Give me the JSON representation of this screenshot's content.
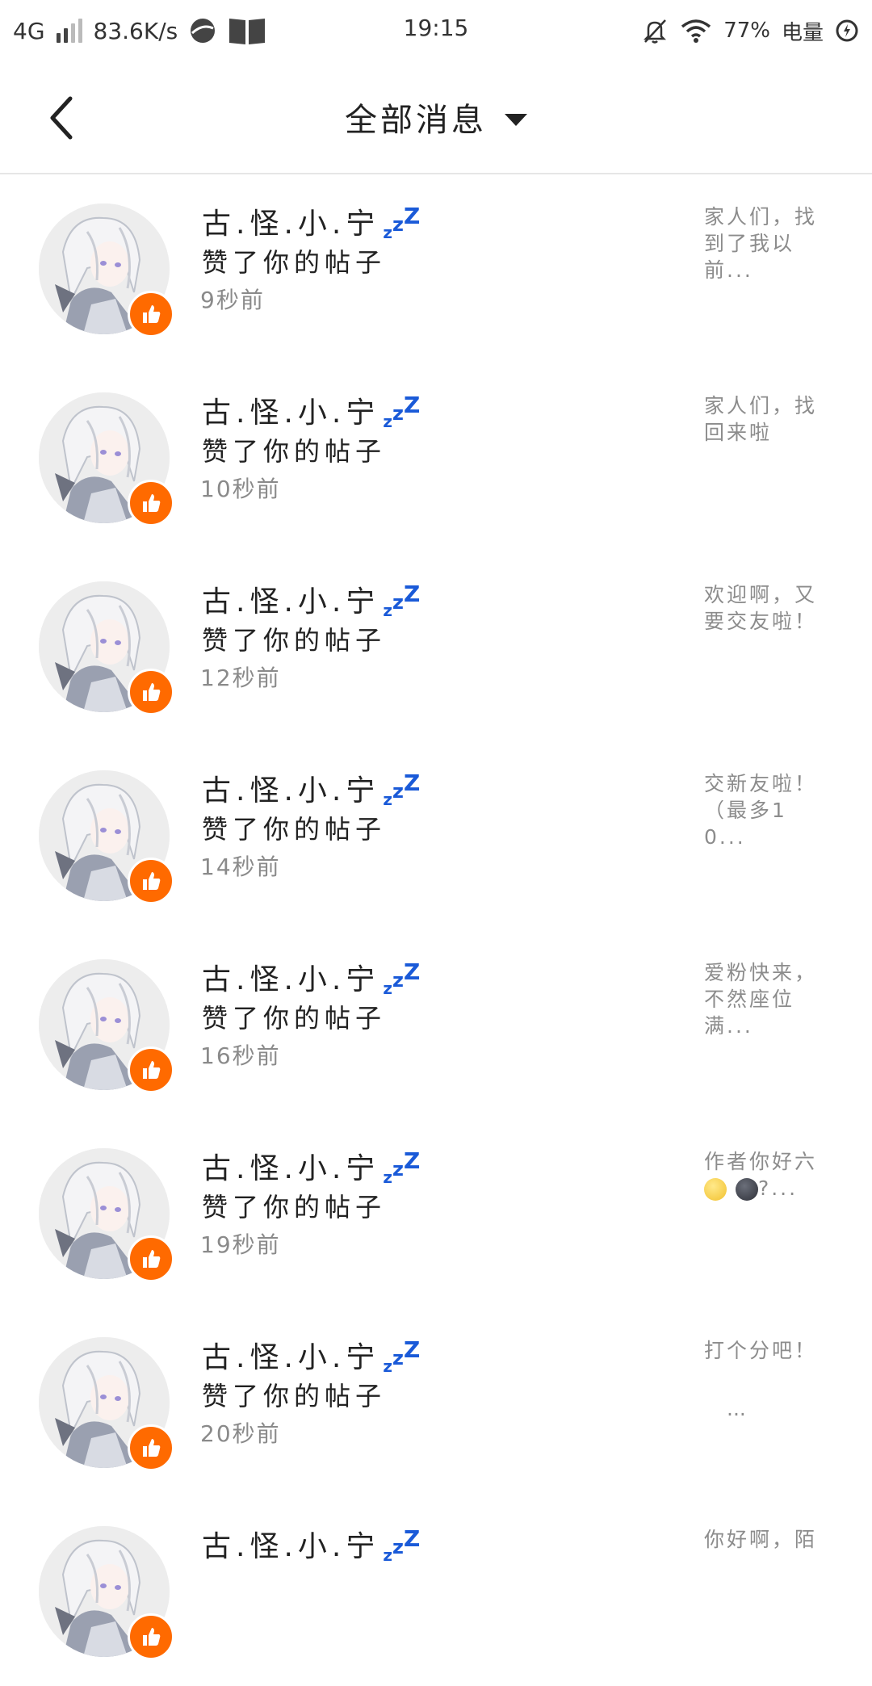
{
  "status_bar": {
    "network": "4G",
    "speed": "83.6K/s",
    "time": "19:15",
    "battery": "77%",
    "battery_label": "电量",
    "icons": [
      "signal-icon",
      "browser-icon",
      "book-icon",
      "mute-icon",
      "wifi-icon",
      "battery-icon"
    ]
  },
  "header": {
    "title": "全部消息",
    "back_icon": "chevron-left-icon",
    "dropdown_icon": "caret-down-icon"
  },
  "colors": {
    "badge": "#ff6a00",
    "zzz": "#1a5ad8",
    "divider": "#e6e6e6"
  },
  "messages": [
    {
      "name": "古.怪.小.宁",
      "zzz": "zzZ",
      "action": "赞了你的帖子",
      "time": "9秒前",
      "preview": "家人们，找到了我以前..."
    },
    {
      "name": "古.怪.小.宁",
      "zzz": "zzZ",
      "action": "赞了你的帖子",
      "time": "10秒前",
      "preview": "家人们，找回来啦"
    },
    {
      "name": "古.怪.小.宁",
      "zzz": "zzZ",
      "action": "赞了你的帖子",
      "time": "12秒前",
      "preview": "欢迎啊，又要交友啦！"
    },
    {
      "name": "古.怪.小.宁",
      "zzz": "zzZ",
      "action": "赞了你的帖子",
      "time": "14秒前",
      "preview": "交新友啦！（最多10..."
    },
    {
      "name": "古.怪.小.宁",
      "zzz": "zzZ",
      "action": "赞了你的帖子",
      "time": "16秒前",
      "preview": "爱粉快来，不然座位满..."
    },
    {
      "name": "古.怪.小.宁",
      "zzz": "zzZ",
      "action": "赞了你的帖子",
      "time": "19秒前",
      "preview": "作者你好六",
      "preview_tail": "?..."
    },
    {
      "name": "古.怪.小.宁",
      "zzz": "zzZ",
      "action": "赞了你的帖子",
      "time": "20秒前",
      "preview": "打个分吧！",
      "preview_ellipsis": "..."
    },
    {
      "name": "古.怪.小.宁",
      "zzz": "zzZ",
      "action": "",
      "time": "",
      "preview": "你好啊，陌"
    }
  ]
}
